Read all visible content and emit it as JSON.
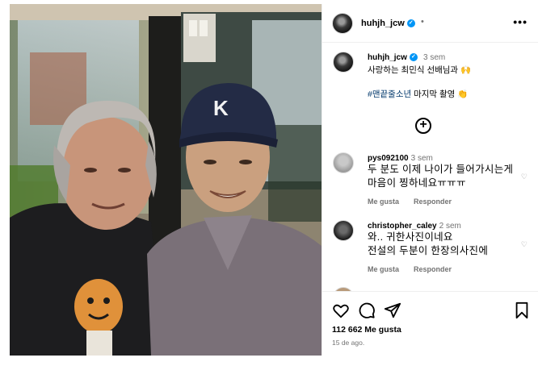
{
  "post": {
    "username": "huhjh_jcw",
    "header_separator": "•",
    "more_label": "•••",
    "photo_cap_logo": "K"
  },
  "caption": {
    "username": "huhjh_jcw",
    "time": "3 sem",
    "line1": "사랑하는 최민식 선배님과 🙌",
    "hashtag": "#맨끝줄소년",
    "line2_rest": "마지막 촬영 👏",
    "add_label": "+"
  },
  "comments": [
    {
      "username": "pys092100",
      "time": "3 sem",
      "text_line1": "두 분도 이제 나이가 들어가시는게",
      "text_line2": "마음이 찡하네요ㅠㅠㅠ",
      "like_label": "Me gusta",
      "reply_label": "Responder"
    },
    {
      "username": "christopher_caley",
      "time": "2 sem",
      "text_line1": "와.. 귀한사진이네요",
      "text_line2": "전설의 두분이 한장의사진에",
      "like_label": "Me gusta",
      "reply_label": "Responder"
    }
  ],
  "actions": {
    "likes_count": "112 662 Me gusta",
    "date": "15 de ago."
  },
  "icons": {
    "verified": "verified-badge-icon",
    "more": "more-options-icon",
    "add": "add-circle-icon",
    "like": "heart-icon",
    "comment": "comment-bubble-icon",
    "share": "paper-plane-icon",
    "save": "bookmark-icon"
  },
  "colors": {
    "verified": "#0095f6",
    "hashtag": "#00376b",
    "muted": "#737373",
    "divider": "#efefef"
  }
}
